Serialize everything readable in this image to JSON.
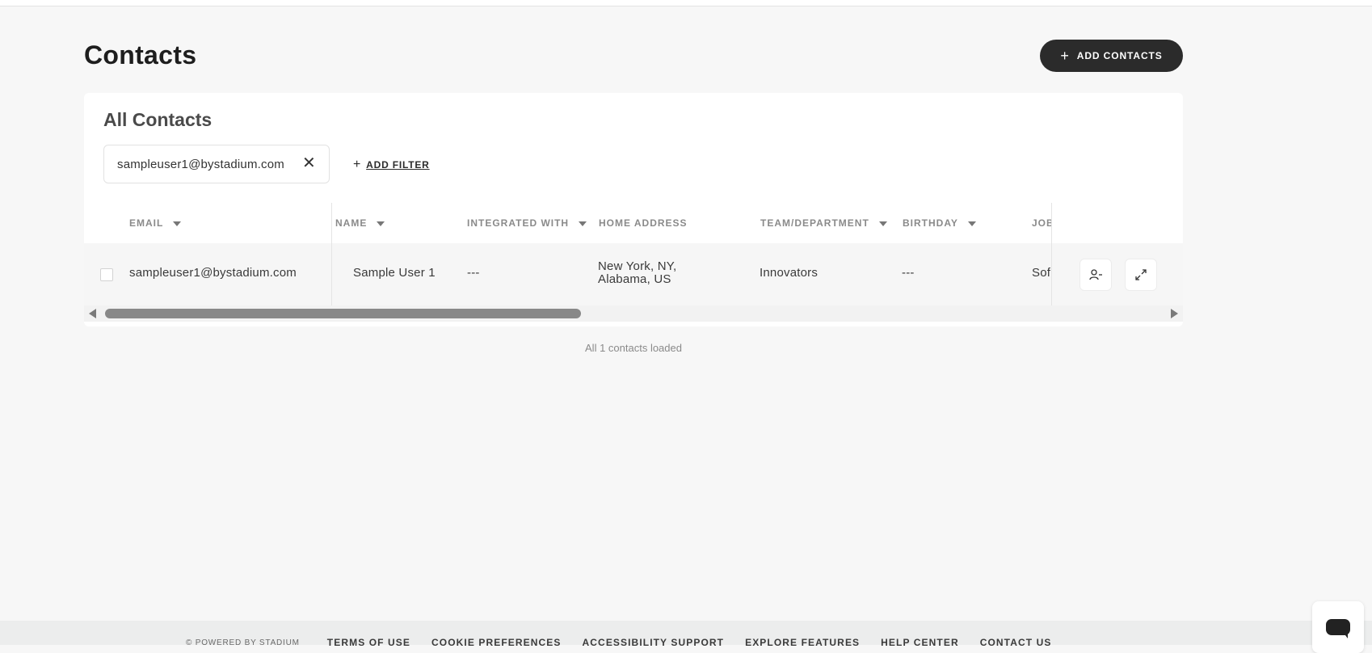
{
  "header": {
    "title": "Contacts",
    "add_button_label": "ADD CONTACTS",
    "add_button_icon": "plus-icon"
  },
  "card": {
    "title": "All Contacts",
    "filter_chip": {
      "value": "sampleuser1@bystadium.com",
      "remove_icon": "close-icon"
    },
    "add_filter_label": "ADD FILTER"
  },
  "table": {
    "columns": [
      {
        "label": "EMAIL",
        "sortable": true
      },
      {
        "label": "NAME",
        "sortable": true
      },
      {
        "label": "INTEGRATED WITH",
        "sortable": true
      },
      {
        "label": "HOME ADDRESS",
        "sortable": false
      },
      {
        "label": "TEAM/DEPARTMENT",
        "sortable": true
      },
      {
        "label": "BIRTHDAY",
        "sortable": true
      },
      {
        "label": "JOB",
        "sortable": false
      }
    ],
    "rows": [
      {
        "email": "sampleuser1@bystadium.com",
        "name": "Sample User 1",
        "integrated_with": "---",
        "home_address_line1": "New York, NY,",
        "home_address_line2": "Alabama, US",
        "team": "Innovators",
        "birthday": "---",
        "job": "Sof",
        "actions": [
          "remove-user-icon",
          "expand-icon"
        ]
      }
    ],
    "horizontal_scroll_fraction": 0.45
  },
  "status": {
    "loaded_text": "All 1 contacts loaded"
  },
  "footer": {
    "powered_by": "© POWERED BY STADIUM",
    "links": [
      "TERMS OF USE",
      "COOKIE PREFERENCES",
      "ACCESSIBILITY SUPPORT",
      "EXPLORE FEATURES",
      "HELP CENTER",
      "CONTACT US"
    ]
  },
  "chat": {
    "icon": "chat-bubble-icon"
  },
  "colors": {
    "background": "#f7f7f7",
    "primary_button": "#2b2b2b",
    "card": "#ffffff",
    "header_text": "#8a8a8a"
  }
}
